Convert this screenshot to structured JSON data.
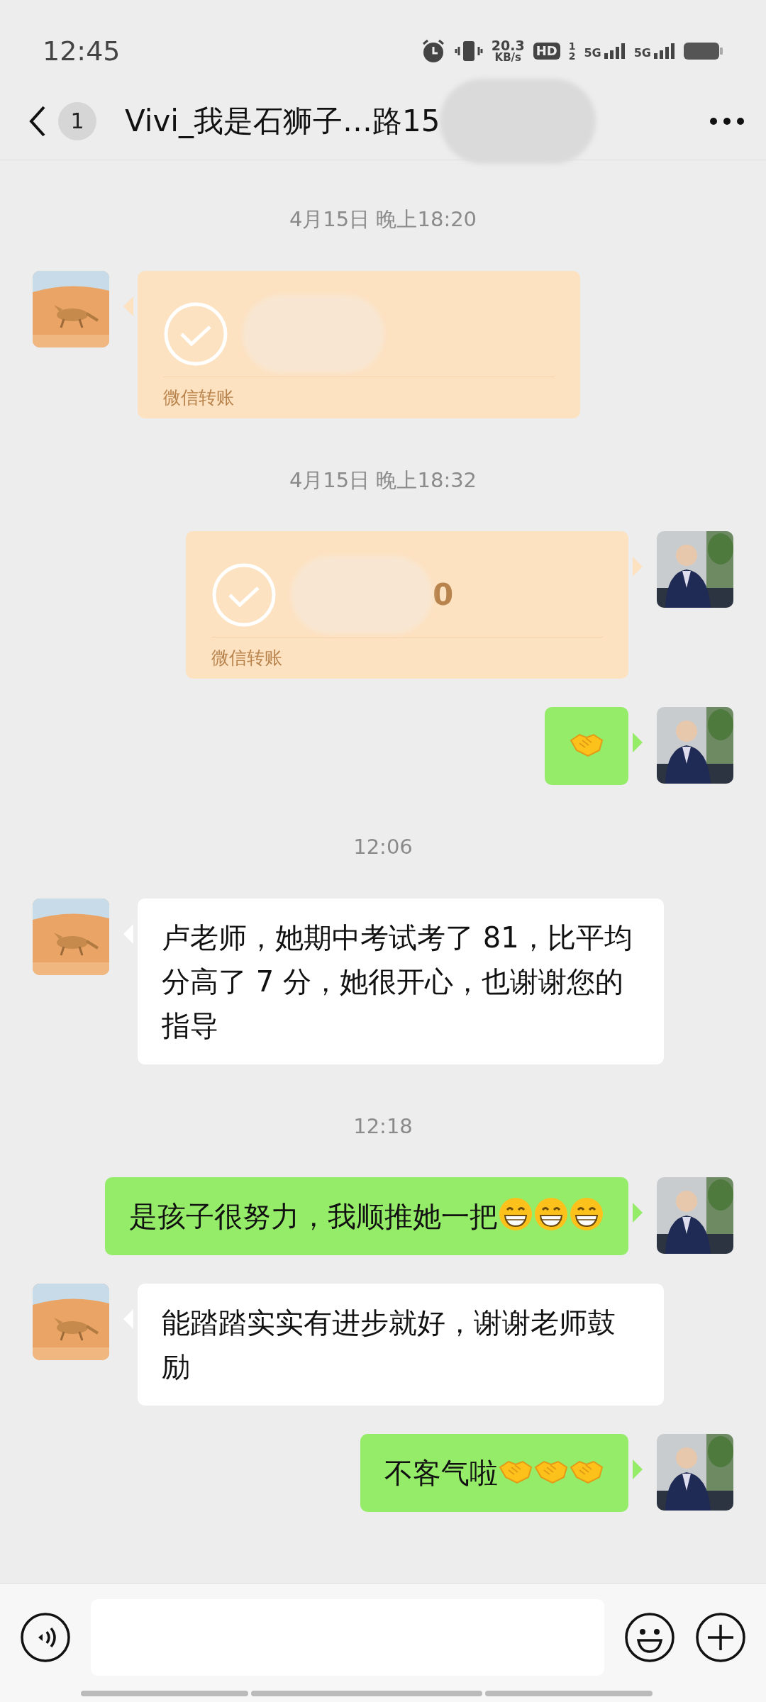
{
  "status_bar": {
    "time": "12:45",
    "speed": "20.3",
    "speed_unit": "KB/s",
    "hd": "HD",
    "hd_sims": [
      "1",
      "2"
    ],
    "networks": [
      "5G",
      "5G"
    ]
  },
  "header": {
    "unread": "1",
    "title": "Vivi_我是石狮子…路15"
  },
  "messages": [
    {
      "kind": "time",
      "text": "4月15日 晚上18:20"
    },
    {
      "kind": "transfer",
      "outgoing": false,
      "label": "微信转账"
    },
    {
      "kind": "time",
      "text": "4月15日 晚上18:32"
    },
    {
      "kind": "transfer",
      "outgoing": true,
      "amount": "0",
      "label": "微信转账"
    },
    {
      "kind": "text",
      "outgoing": true,
      "emojis": [
        {
          "kind": "handshake"
        }
      ]
    },
    {
      "kind": "time",
      "text": "12:06"
    },
    {
      "kind": "text",
      "outgoing": false,
      "text": "卢老师，她期中考试考了 81，比平均分高了 7 分，她很开心，也谢谢您的指导"
    },
    {
      "kind": "time",
      "text": "12:18"
    },
    {
      "kind": "text",
      "outgoing": true,
      "text": "是孩子很努力，我顺推她一把",
      "emojis": [
        {
          "kind": "grin"
        },
        {
          "kind": "grin"
        },
        {
          "kind": "grin"
        }
      ]
    },
    {
      "kind": "text",
      "outgoing": false,
      "text": "能踏踏实实有进步就好，谢谢老师鼓励"
    },
    {
      "kind": "text",
      "outgoing": true,
      "text": "不客气啦",
      "emojis": [
        {
          "kind": "handshake"
        },
        {
          "kind": "handshake"
        },
        {
          "kind": "handshake"
        }
      ]
    }
  ]
}
